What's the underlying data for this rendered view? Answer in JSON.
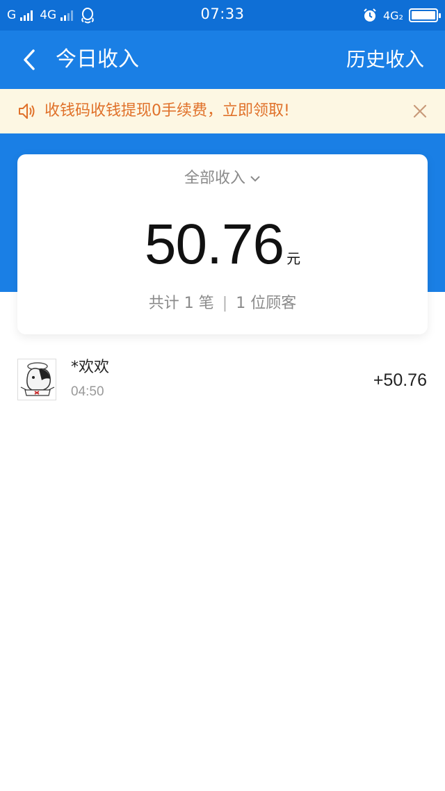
{
  "status_bar": {
    "carrier1": "G",
    "carrier2": "4G",
    "time": "07:33",
    "network": "4G₂"
  },
  "nav": {
    "title": "今日收入",
    "history_label": "历史收入"
  },
  "notice": {
    "text": "收钱码收钱提现0手续费，立即领取!"
  },
  "summary": {
    "filter_label": "全部收入",
    "amount": "50.76",
    "currency": "元",
    "count_prefix": "共计",
    "count": "1",
    "count_unit": "笔",
    "separator": "|",
    "customers": "1",
    "customers_unit": "位顾客"
  },
  "transactions": [
    {
      "name": "*欢欢",
      "time": "04:50",
      "amount": "+50.76"
    }
  ],
  "colors": {
    "brand_blue": "#1a7fe5",
    "notice_bg": "#fdf7e3",
    "notice_text": "#e0712a"
  }
}
